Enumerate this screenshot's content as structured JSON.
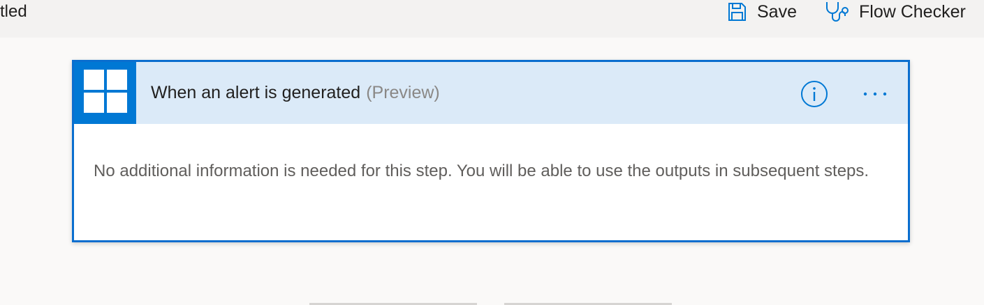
{
  "topbar": {
    "title_fragment": "tled",
    "save_label": "Save",
    "save_icon": "floppy-disk-icon",
    "checker_label": "Flow Checker",
    "checker_icon": "stethoscope-icon"
  },
  "card": {
    "title": "When an alert is generated",
    "tag": "(Preview)",
    "connector_icon": "windows-logo-icon",
    "info_icon": "info-icon",
    "more_icon": "more-options-icon",
    "body_text": "No additional information is needed for this step. You will be able to use the outputs in subsequent steps."
  },
  "colors": {
    "accent": "#0078d4",
    "header_bg": "#dbeaf8",
    "card_border": "#0a6ecf"
  }
}
